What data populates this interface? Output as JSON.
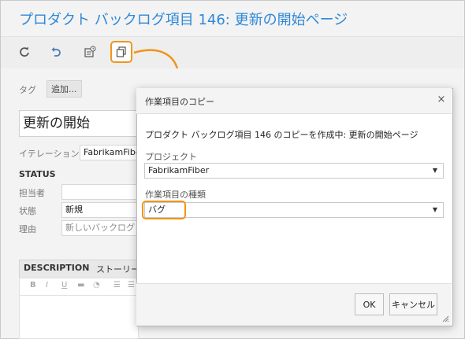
{
  "header": {
    "title": "プロダクト バックログ項目 146: 更新の開始ページ"
  },
  "toolbar": {
    "refresh_icon": "refresh-icon",
    "undo_icon": "undo-icon",
    "history_icon": "history-icon",
    "copy_icon": "copy-icon"
  },
  "form": {
    "tags_label": "タグ",
    "tags_add": "追加...",
    "title_value": "更新の開始",
    "iteration_label": "イテレーション",
    "iteration_value": "FabrikamFiber",
    "status_heading": "STATUS",
    "assigned_label": "担当者",
    "assigned_value": "",
    "state_label": "状態",
    "state_value": "新規",
    "reason_label": "理由",
    "reason_value": "新しいバックログ",
    "description_tab": "DESCRIPTION",
    "story_tab": "ストーリー",
    "format_buttons": [
      "B",
      "I",
      "U"
    ]
  },
  "dialog": {
    "title": "作業項目のコピー",
    "close": "×",
    "message": "プロダクト バックログ項目 146 のコピーを作成中: 更新の開始ページ",
    "project_label": "プロジェクト",
    "project_value": "FabrikamFiber",
    "type_label": "作業項目の種類",
    "type_value": "バグ",
    "ok_label": "OK",
    "cancel_label": "キャンセル"
  },
  "colors": {
    "accent": "#2d88d8",
    "highlight": "#f0951a"
  }
}
